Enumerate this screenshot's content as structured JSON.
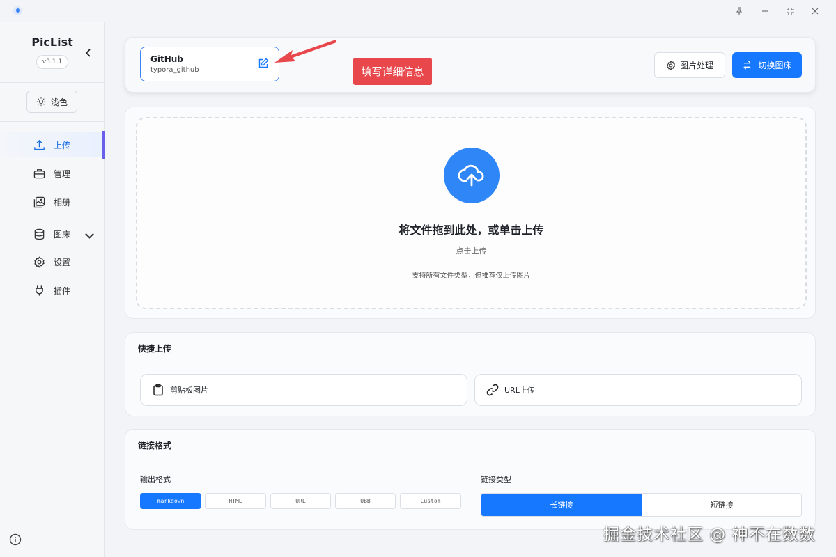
{
  "titlebar": {
    "pin": "pin-icon",
    "minimize": "minimize-icon",
    "maximize": "maximize-icon",
    "close": "close-icon"
  },
  "sidebar": {
    "app_name": "PicList",
    "version": "v3.1.1",
    "theme_label": "浅色",
    "items": [
      {
        "label": "上传",
        "icon": "upload-icon",
        "active": true
      },
      {
        "label": "管理",
        "icon": "briefcase-icon",
        "active": false
      },
      {
        "label": "相册",
        "icon": "gallery-icon",
        "active": false
      },
      {
        "label": "图床",
        "icon": "database-icon",
        "active": false
      },
      {
        "label": "设置",
        "icon": "gear-icon",
        "active": false
      },
      {
        "label": "插件",
        "icon": "plug-icon",
        "active": false
      }
    ]
  },
  "header": {
    "picbed_name": "GitHub",
    "picbed_config": "typora_github",
    "annotation": "填写详细信息",
    "process_label": "图片处理",
    "switch_label": "切换图床"
  },
  "upload": {
    "title": "将文件拖到此处，或单击上传",
    "subtitle": "点击上传",
    "hint": "支持所有文件类型，但推荐仅上传图片"
  },
  "quick": {
    "title": "快捷上传",
    "clipboard_label": "剪贴板图片",
    "url_label": "URL上传"
  },
  "link_format": {
    "title": "链接格式",
    "output_label": "输出格式",
    "formats": [
      "markdown",
      "HTML",
      "URL",
      "UBB",
      "Custom"
    ],
    "selected_format": "markdown",
    "link_type_label": "链接类型",
    "long_link": "长链接",
    "short_link": "短链接",
    "selected_link_type": "长链接"
  },
  "watermark": "掘金技术社区 @ 神不在数数",
  "colors": {
    "accent": "#1677ff",
    "annotation": "#e8484c",
    "active_indicator": "#6a5fe8"
  }
}
